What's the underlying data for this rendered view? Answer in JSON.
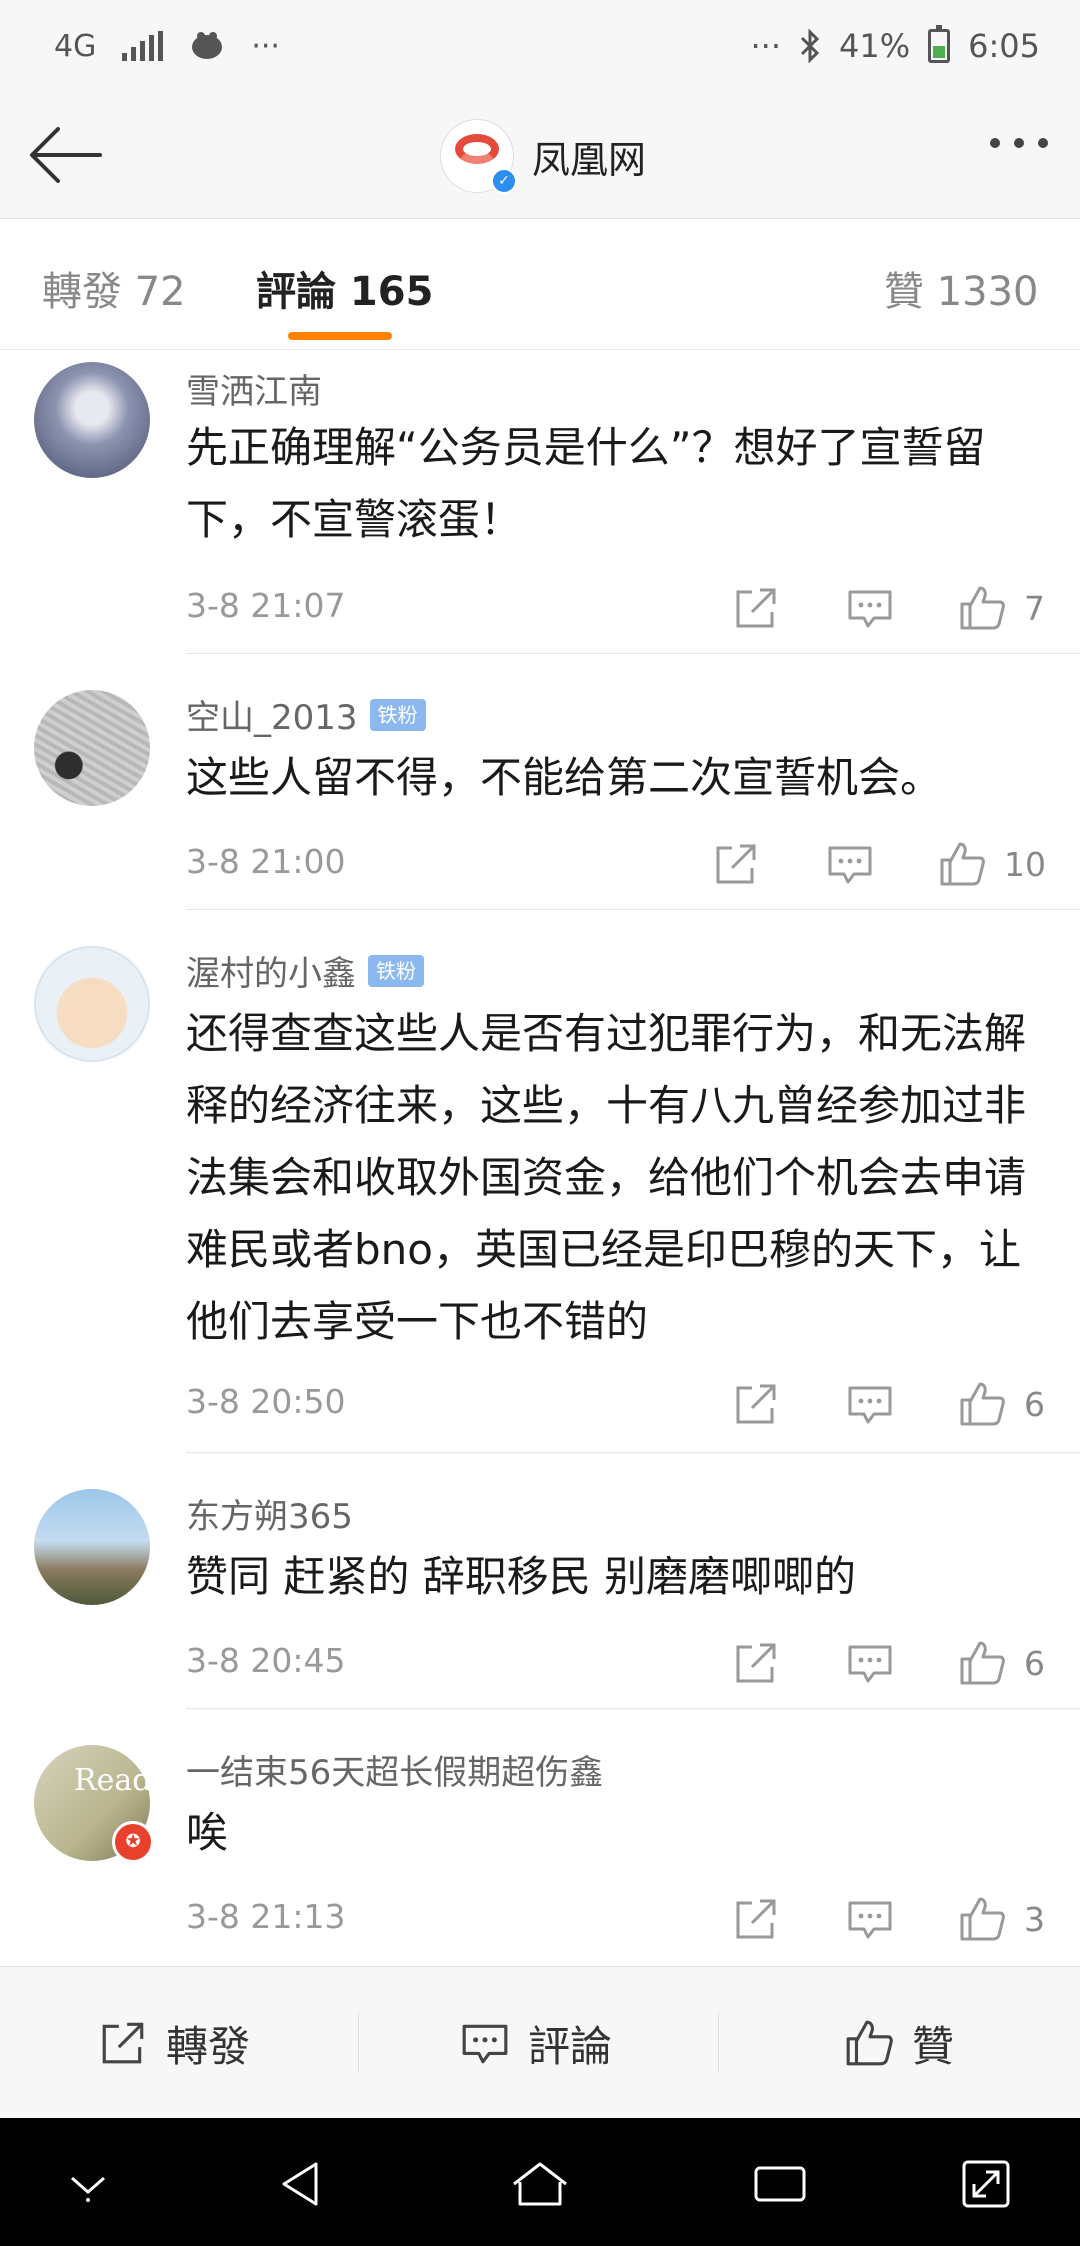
{
  "status_bar": {
    "network": "4G",
    "left_more": "···",
    "right_more": "···",
    "battery": "41%",
    "time": "6:05"
  },
  "app_bar": {
    "title": "凤凰网",
    "logo_text": "凤凰网"
  },
  "tabs": {
    "repost": "轉發 72",
    "comment": "評論 165",
    "like": "贊 1330"
  },
  "comments": [
    {
      "user": "雪洒江南",
      "badge": "",
      "text": "先正确理解“公务员是什么”？想好了宣誓留下，不宣警滚蛋！",
      "time": "3-8 21:07",
      "likes": "7"
    },
    {
      "user": "空山_2013",
      "badge": "铁粉",
      "text": "这些人留不得，不能给第二次宣誓机会。",
      "time": "3-8 21:00",
      "likes": "10"
    },
    {
      "user": "渥村的小鑫",
      "badge": "铁粉",
      "text": "还得查查这些人是否有过犯罪行为，和无法解释的经济往来，这些，十有八九曾经参加过非法集会和收取外国资金，给他们个机会去申请难民或者bno，英国已经是印巴穆的天下，让他们去享受一下也不错的",
      "time": "3-8 20:50",
      "likes": "6"
    },
    {
      "user": "东方朔365",
      "badge": "",
      "text": "赞同 赶紧的 辞职移民 别磨磨唧唧的",
      "time": "3-8 20:45",
      "likes": "6"
    },
    {
      "user": "一结束56天超长假期超伤鑫",
      "badge": "",
      "text": "唉",
      "time": "3-8 21:13",
      "likes": "3",
      "avatar_text": "Read"
    }
  ],
  "action_bar": {
    "repost": "轉發",
    "comment": "評論",
    "like": "贊"
  },
  "colors": {
    "accent": "#ff8200",
    "badge": "#8ab8ef",
    "verified": "#2b8ef0"
  }
}
